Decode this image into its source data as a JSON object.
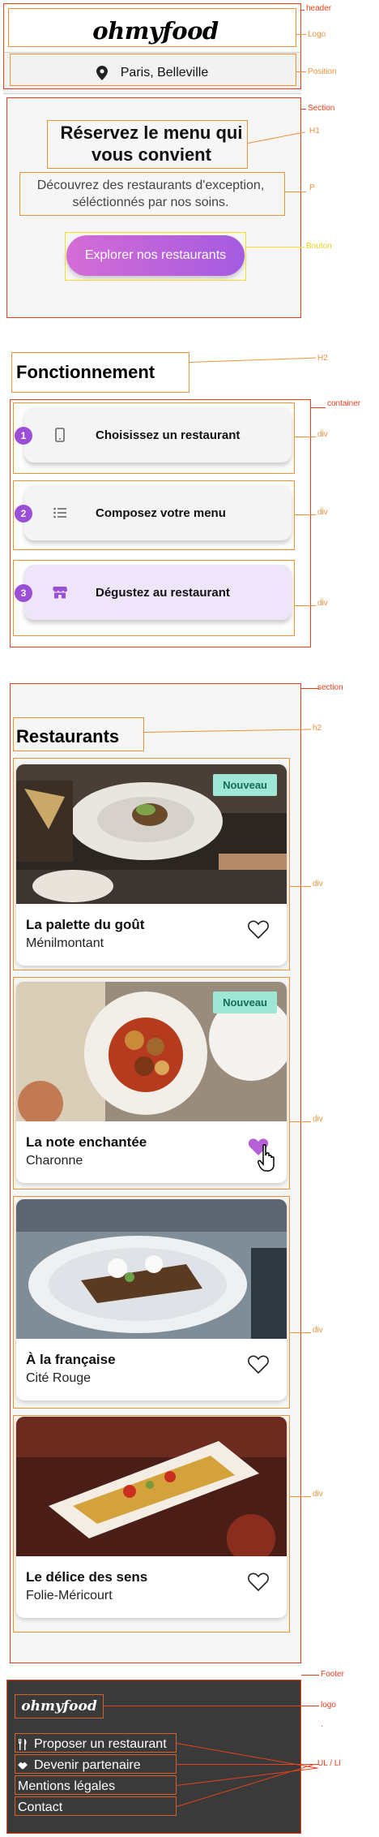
{
  "header": {
    "logo": "ohmyfood",
    "position": "Paris, Belleville"
  },
  "hero": {
    "title": "Réservez le menu qui vous convient",
    "subtitle": "Découvrez des restaurants d'exception, séléctionnés par nos soins.",
    "button": "Explorer nos restaurants"
  },
  "how": {
    "title": "Fonctionnement",
    "steps": [
      {
        "number": "1",
        "icon": "phone-icon",
        "label": "Choisissez un restaurant"
      },
      {
        "number": "2",
        "icon": "list-icon",
        "label": "Composez votre menu"
      },
      {
        "number": "3",
        "icon": "store-icon",
        "label": "Dégustez au restaurant"
      }
    ]
  },
  "restaurants": {
    "title": "Restaurants",
    "items": [
      {
        "name": "La palette du goût",
        "area": "Ménilmontant",
        "badge": "Nouveau",
        "liked": false
      },
      {
        "name": "La note enchantée",
        "area": "Charonne",
        "badge": "Nouveau",
        "liked": true
      },
      {
        "name": "À la française",
        "area": "Cité Rouge",
        "badge": "",
        "liked": false
      },
      {
        "name": "Le délice des sens",
        "area": "Folie-Méricourt",
        "badge": "",
        "liked": false
      }
    ]
  },
  "footer": {
    "logo": "ohmyfood",
    "links": [
      {
        "label": "Proposer un restaurant",
        "icon": "utensils-icon"
      },
      {
        "label": "Devenir partenaire",
        "icon": "handshake-icon"
      },
      {
        "label": "Mentions légales",
        "icon": ""
      },
      {
        "label": "Contact",
        "icon": ""
      }
    ]
  },
  "annotations": {
    "header": "header",
    "logo": "Logo",
    "position": "Position",
    "section": "Section",
    "h1": "H1",
    "p": "P",
    "bouton": "Bouton",
    "h2": "H2",
    "container": "container",
    "div": "div",
    "section2": "section",
    "h2b": "h2",
    "footer": "Footer",
    "logo2": "logo",
    "ul": "UL / LI",
    "dot": "."
  },
  "colors": {
    "accent": "#9b4fd6",
    "button_start": "#d56cd6",
    "button_end": "#a45be0",
    "badge_bg": "#9ee7d6",
    "badge_text": "#156a58",
    "annotation": "#e8401c",
    "footer_bg": "#3a3a3a"
  }
}
